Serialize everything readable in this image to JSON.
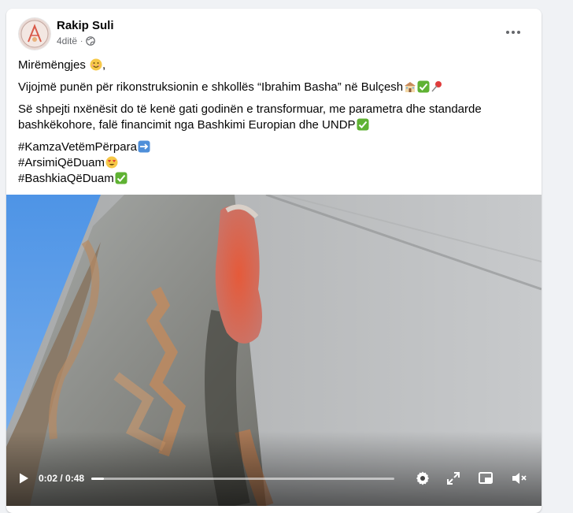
{
  "post": {
    "author": "Rakip Suli",
    "time": "4ditë",
    "privacy_icon": "globe-icon",
    "greeting": "Mirëmëngjes ",
    "paragraph1": "Vijojmë punën për rikonstruksionin e shkollës “Ibrahim Basha” në Bulçesh",
    "paragraph2": "Së shpejti nxënësit do të kenë gati godinën e transformuar, me parametra dhe standarde bashkëkohore, falë financimit nga Bashkimi Europian dhe UNDP",
    "hashtags": [
      "#KamzaVetëmPërpara",
      "#ArsimiQëDuam",
      "#BashkiaQëDuam"
    ]
  },
  "video": {
    "current_time": "0:02",
    "separator": " / ",
    "duration": "0:48",
    "progress_fraction": 0.042
  },
  "colors": {
    "accent_text": "#050505",
    "secondary_text": "#65676b",
    "card_bg": "#ffffff",
    "page_bg": "#f0f2f5"
  }
}
